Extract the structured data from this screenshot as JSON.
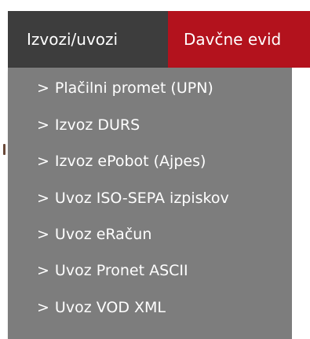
{
  "menubar": {
    "active_tab": "Izvozi/uvozi",
    "next_tab": "Davčne evid"
  },
  "dropdown": {
    "bullet": ">",
    "items": [
      "Plačilni promet (UPN)",
      "Izvoz DURS",
      "Izvoz ePobot (Ajpes)",
      "Uvoz ISO-SEPA izpiskov",
      "Uvoz eRačun",
      "Uvoz Pronet ASCII",
      "Uvoz VOD XML"
    ]
  },
  "colors": {
    "active_tab_bg": "#3d3d3d",
    "red_tab_bg": "#b3121d",
    "dropdown_bg": "#7d7d7d",
    "text": "#ffffff"
  }
}
